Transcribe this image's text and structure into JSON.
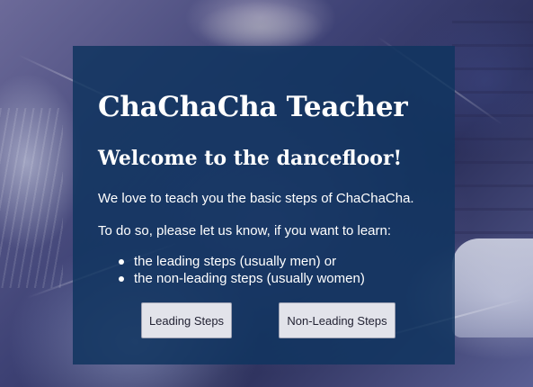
{
  "app": {
    "title": "ChaChaCha Teacher",
    "welcome_heading": "Welcome to the dancefloor!",
    "intro_text": "We love to teach you the basic steps of ChaChaCha.",
    "prompt_text": "To do so, please let us know, if you want to learn:",
    "options": [
      "the leading steps (usually men) or",
      "the non-leading steps (usually women)"
    ],
    "buttons": {
      "leading_label": "Leading Steps",
      "non_leading_label": "Non-Leading Steps"
    }
  },
  "colors": {
    "panel_background": "#103460",
    "text": "#ffffff",
    "button_background": "#e2e3ea"
  }
}
